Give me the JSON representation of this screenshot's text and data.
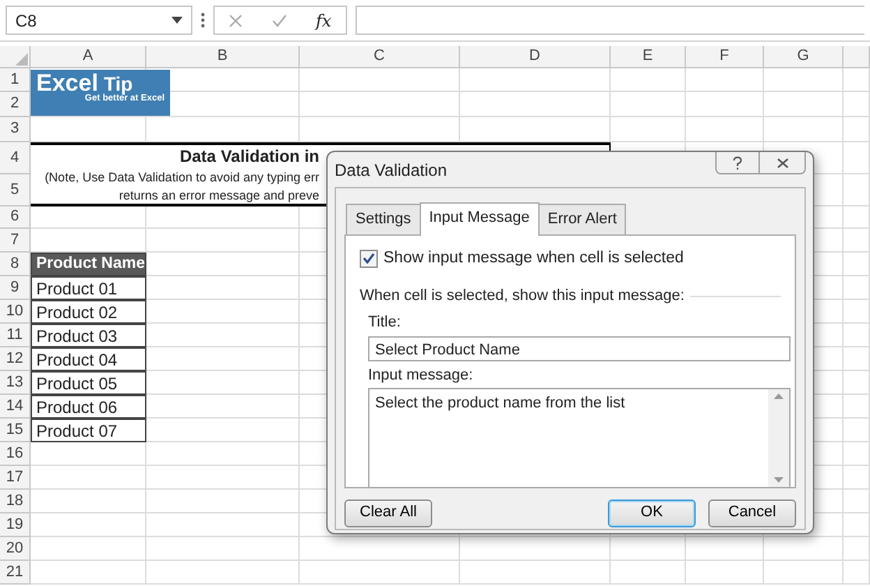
{
  "formula_bar": {
    "name_box": "C8",
    "function_label": "fx"
  },
  "columns": [
    "A",
    "B",
    "C",
    "D",
    "E",
    "F",
    "G",
    ""
  ],
  "rows": [
    "1",
    "2",
    "3",
    "4",
    "5",
    "6",
    "7",
    "8",
    "9",
    "10",
    "11",
    "12",
    "13",
    "14",
    "15",
    "16",
    "17",
    "18",
    "19",
    "20",
    "21"
  ],
  "logo": {
    "word_1": "Excel",
    "word_2": "Tip",
    "tagline": "Get better at Excel"
  },
  "banner": {
    "title": "Data Validation in",
    "note_line_1": "(Note, Use Data Validation to avoid any typing err",
    "note_line_2": "returns an error message and preve"
  },
  "product_table": {
    "header": "Product Name",
    "rows": [
      "Product 01",
      "Product 02",
      "Product 03",
      "Product 04",
      "Product 05",
      "Product 06",
      "Product 07"
    ]
  },
  "dialog": {
    "title": "Data Validation",
    "tabs": [
      {
        "label": "Settings",
        "selected": false
      },
      {
        "label": "Input Message",
        "selected": true
      },
      {
        "label": "Error Alert",
        "selected": false
      }
    ],
    "show_message": {
      "label": "Show input message when cell is selected",
      "checked": true
    },
    "group_label": "When cell is selected, show this input message:",
    "title_label": "Title:",
    "title_value": "Select Product Name",
    "message_label": "Input message:",
    "message_value": "Select the product name from the list",
    "buttons": [
      {
        "label": "Clear All",
        "default": false
      },
      {
        "label": "OK",
        "default": true
      },
      {
        "label": "Cancel",
        "default": false
      }
    ]
  }
}
